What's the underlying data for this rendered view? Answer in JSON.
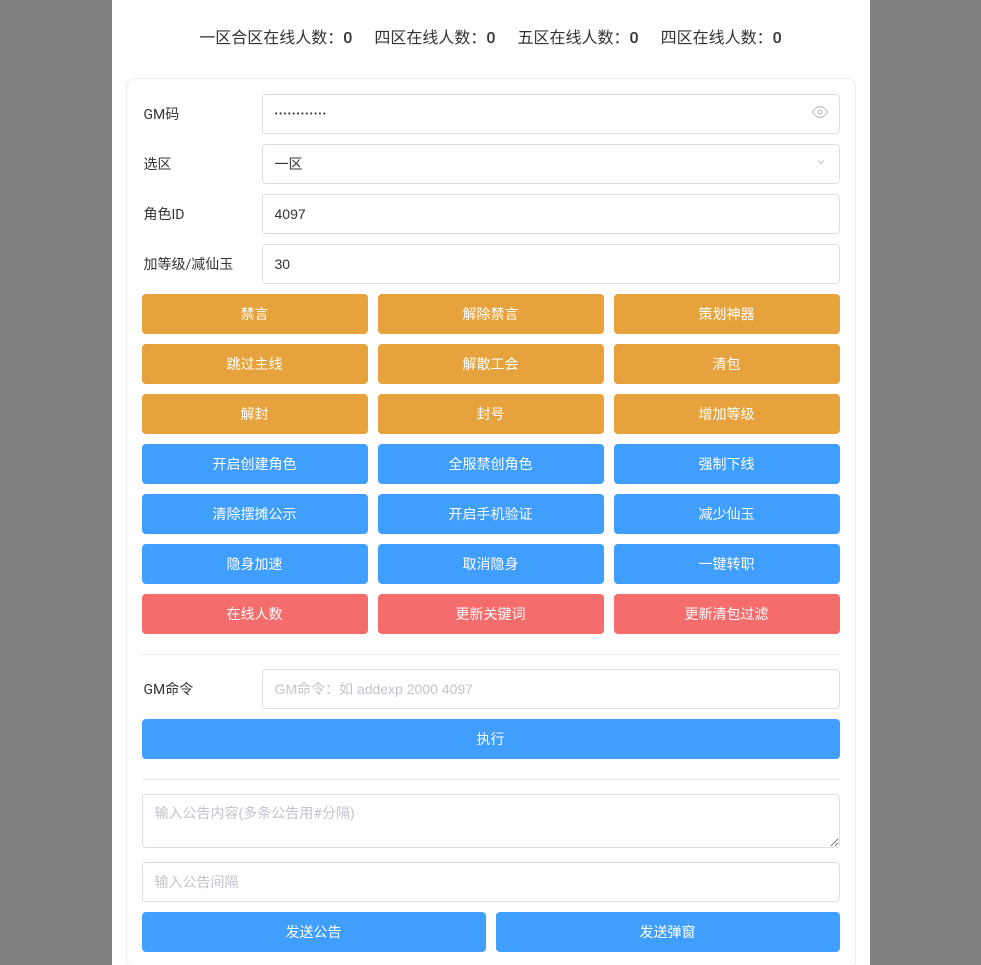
{
  "header": {
    "stats": [
      {
        "label": "一区合区在线人数",
        "value": "0"
      },
      {
        "label": "四区在线人数",
        "value": "0"
      },
      {
        "label": "五区在线人数",
        "value": "0"
      },
      {
        "label": "四区在线人数",
        "value": "0"
      }
    ]
  },
  "form": {
    "gm_code_label": "GM码",
    "gm_code_value": "••••••••••••",
    "region_label": "选区",
    "region_value": "一区",
    "role_id_label": "角色ID",
    "role_id_value": "4097",
    "level_label": "加等级/减仙玉",
    "level_value": "30"
  },
  "buttons": {
    "warning": [
      [
        "禁言",
        "解除禁言",
        "策划神器"
      ],
      [
        "跳过主线",
        "解散工会",
        "清包"
      ],
      [
        "解封",
        "封号",
        "增加等级"
      ]
    ],
    "primary": [
      [
        "开启创建角色",
        "全服禁创角色",
        "强制下线"
      ],
      [
        "清除摆摊公示",
        "开启手机验证",
        "减少仙玉"
      ],
      [
        "隐身加速",
        "取消隐身",
        "一键转职"
      ]
    ],
    "danger": [
      [
        "在线人数",
        "更新关键词",
        "更新清包过滤"
      ]
    ]
  },
  "command": {
    "label": "GM命令",
    "placeholder": "GM命令：如 addexp 2000 4097",
    "execute": "执行"
  },
  "announce": {
    "content_placeholder": "输入公告内容(多条公告用#分隔)",
    "interval_placeholder": "输入公告间隔",
    "send_announce": "发送公告",
    "send_popup": "发送弹窗"
  }
}
